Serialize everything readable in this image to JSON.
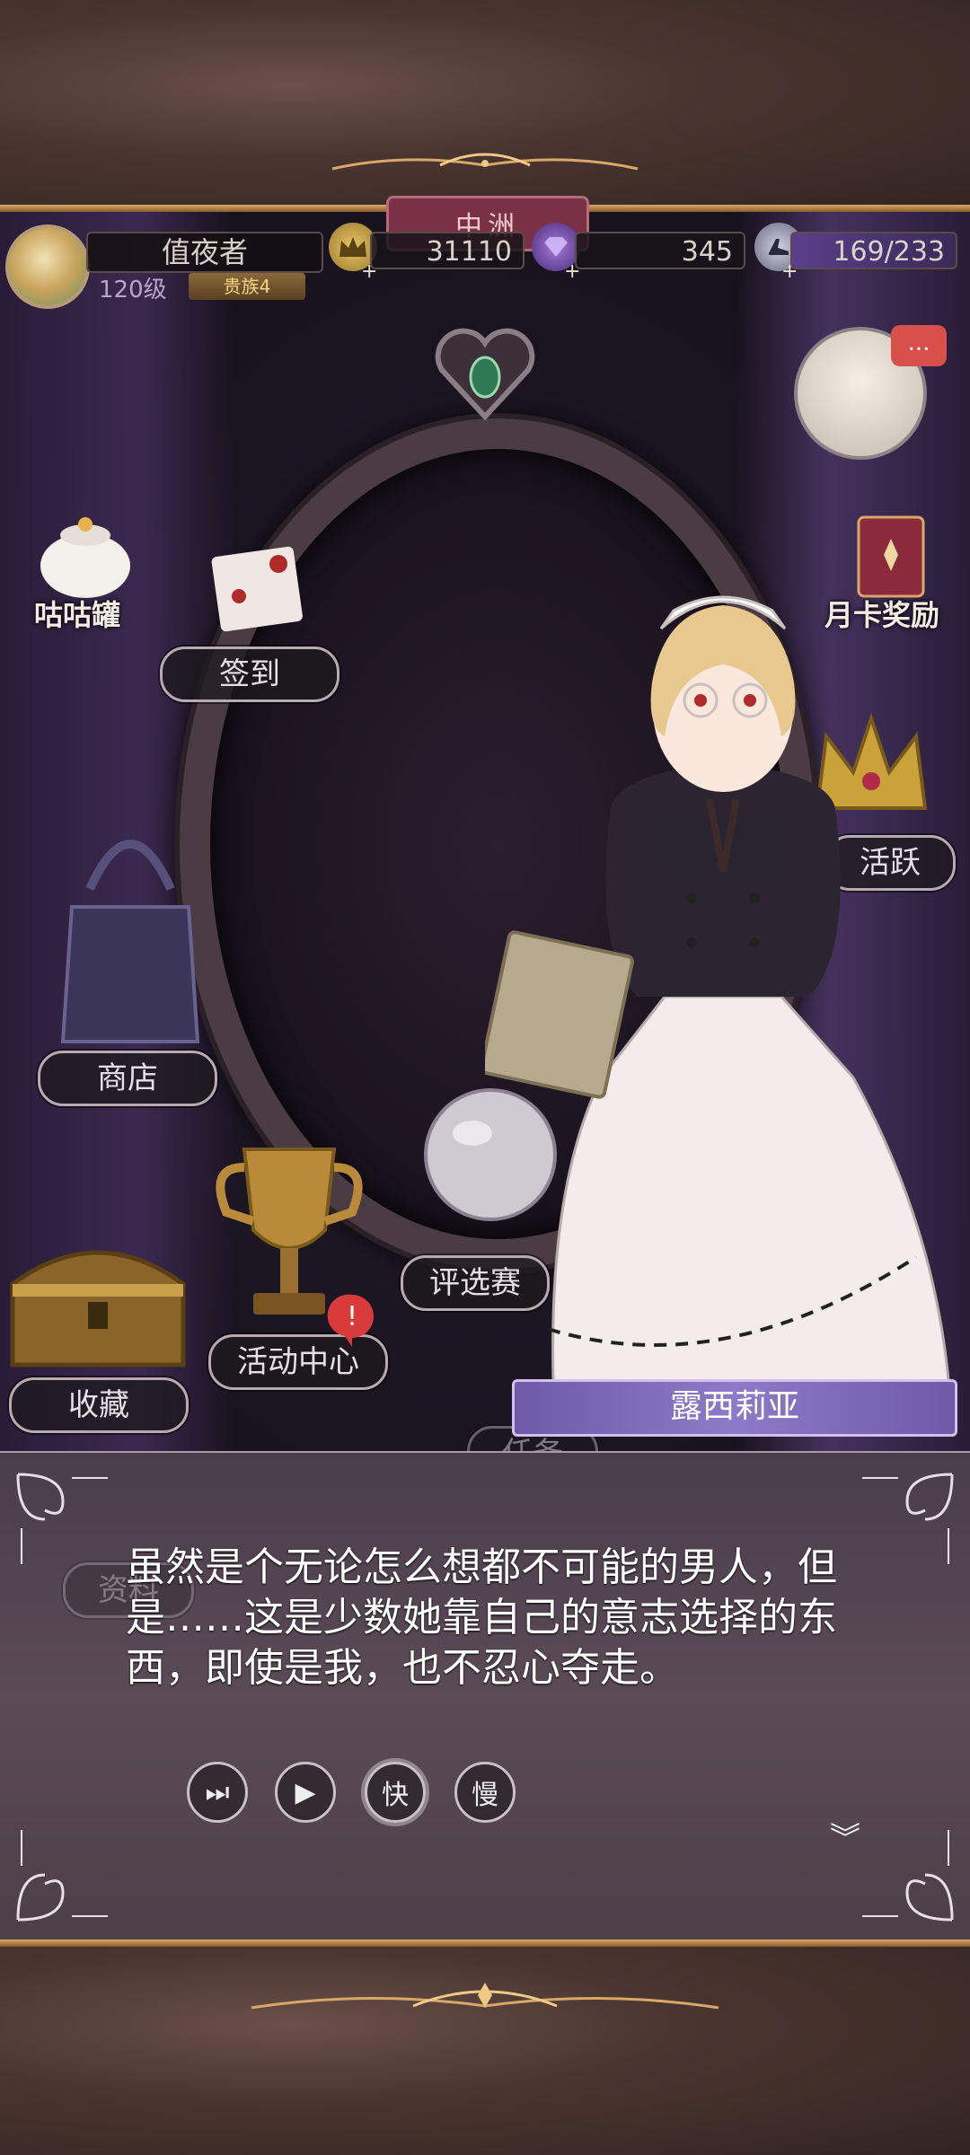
{
  "player": {
    "name": "值夜者",
    "level": "120级",
    "rank": "贵族4"
  },
  "resources": {
    "gold": "31110",
    "gems": "345",
    "stamina": "169/233",
    "plus": "+"
  },
  "location": {
    "region": "中洲"
  },
  "menu": {
    "gugu": "咕咕罐",
    "signin": "签到",
    "monthly": "月卡奖励",
    "active": "活跃",
    "shop": "商店",
    "contest": "评选赛",
    "events": "活动中心",
    "collection": "收藏",
    "tasks": "任务",
    "info": "资料"
  },
  "badges": {
    "events_alert": "!",
    "chat": "..."
  },
  "dialog": {
    "speaker": "露西莉亚",
    "text": "虽然是个无论怎么想都不可能的男人，但是……这是少数她靠自己的意志选择的东西，即使是我，也不忍心夺走。",
    "controls": {
      "skip": "⏭",
      "auto": "▶",
      "fast": "快",
      "slow": "慢"
    },
    "next_indicator": "︾"
  },
  "colors": {
    "frame": "#4a3631",
    "gold_trim": "#d9a767",
    "ribbon": "#7a3045",
    "speaker_bar": "#8d7bc8",
    "dialog_bg": "#5a4b56"
  }
}
